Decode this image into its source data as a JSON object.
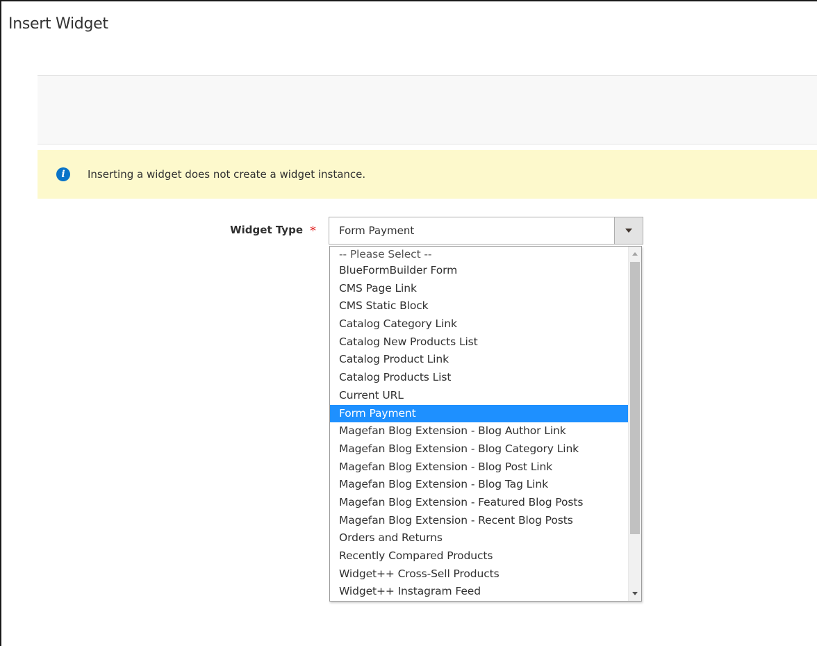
{
  "modal": {
    "title": "Insert Widget"
  },
  "message": {
    "icon": "info-icon",
    "icon_glyph": "i",
    "text": "Inserting a widget does not create a widget instance."
  },
  "widget_type": {
    "label": "Widget Type",
    "required_mark": "*",
    "selected_value": "Form Payment",
    "options": [
      "-- Please Select --",
      "BlueFormBuilder Form",
      "CMS Page Link",
      "CMS Static Block",
      "Catalog Category Link",
      "Catalog New Products List",
      "Catalog Product Link",
      "Catalog Products List",
      "Current URL",
      "Form Payment",
      "Magefan Blog Extension - Blog Author Link",
      "Magefan Blog Extension - Blog Category Link",
      "Magefan Blog Extension - Blog Post Link",
      "Magefan Blog Extension - Blog Tag Link",
      "Magefan Blog Extension - Featured Blog Posts",
      "Magefan Blog Extension - Recent Blog Posts",
      "Orders and Returns",
      "Recently Compared Products",
      "Widget++ Cross-Sell Products",
      "Widget++ Instagram Feed"
    ],
    "selected_index": 9
  },
  "colors": {
    "highlight": "#1e90ff",
    "message_background": "#fdf9cc",
    "info_icon": "#0a74c8",
    "required": "#e22626"
  }
}
